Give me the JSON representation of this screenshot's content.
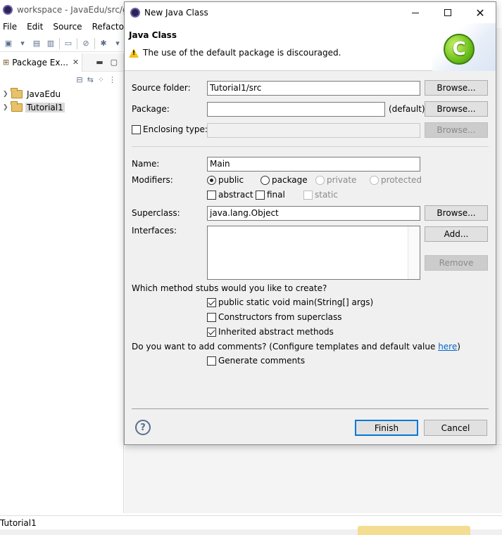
{
  "background": {
    "window_title": "workspace - JavaEdu/src/gra",
    "menu": [
      "File",
      "Edit",
      "Source",
      "Refactor"
    ],
    "package_explorer": {
      "tab_label": "Package Ex...",
      "projects": [
        {
          "name": "JavaEdu",
          "selected": false
        },
        {
          "name": "Tutorial1",
          "selected": true
        }
      ]
    },
    "status_text": "Tutorial1"
  },
  "dialog": {
    "title": "New Java Class",
    "header": {
      "title": "Java Class",
      "message": "The use of the default package is discouraged.",
      "badge_letter": "C"
    },
    "source_folder": {
      "label": "Source folder:",
      "value": "Tutorial1/src",
      "browse": "Browse..."
    },
    "package": {
      "label": "Package:",
      "value": "",
      "suffix": "(default)",
      "browse": "Browse..."
    },
    "enclosing_type": {
      "label": "Enclosing type:",
      "checked": false,
      "value": "",
      "browse": "Browse..."
    },
    "name": {
      "label": "Name:",
      "value": "Main"
    },
    "modifiers": {
      "label": "Modifiers:",
      "access": [
        {
          "label": "public",
          "checked": true,
          "enabled": true
        },
        {
          "label": "package",
          "checked": false,
          "enabled": true
        },
        {
          "label": "private",
          "checked": false,
          "enabled": false
        },
        {
          "label": "protected",
          "checked": false,
          "enabled": false
        }
      ],
      "flags": [
        {
          "label": "abstract",
          "checked": false,
          "enabled": true
        },
        {
          "label": "final",
          "checked": false,
          "enabled": true
        },
        {
          "label": "static",
          "checked": false,
          "enabled": false
        }
      ]
    },
    "superclass": {
      "label": "Superclass:",
      "value": "java.lang.Object",
      "browse": "Browse..."
    },
    "interfaces": {
      "label": "Interfaces:",
      "add": "Add...",
      "remove": "Remove"
    },
    "stubs": {
      "question": "Which method stubs would you like to create?",
      "options": [
        {
          "label": "public static void main(String[] args)",
          "checked": true
        },
        {
          "label": "Constructors from superclass",
          "checked": false
        },
        {
          "label": "Inherited abstract methods",
          "checked": true
        }
      ]
    },
    "comments": {
      "question_prefix": "Do you want to add comments? (Configure templates and default value ",
      "link_text": "here",
      "question_suffix": ")",
      "option": {
        "label": "Generate comments",
        "checked": false
      }
    },
    "footer": {
      "help": "?",
      "finish": "Finish",
      "cancel": "Cancel"
    }
  }
}
